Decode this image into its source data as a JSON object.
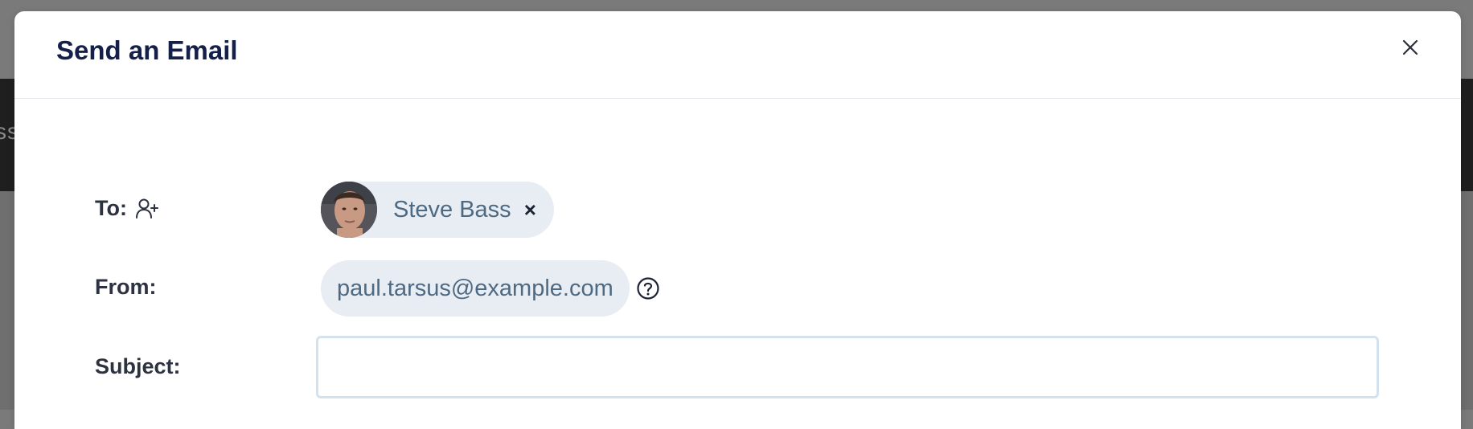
{
  "background": {
    "fragment_text": "ss"
  },
  "modal": {
    "title": "Send an Email",
    "close_icon": "close-icon"
  },
  "form": {
    "to": {
      "label": "To:",
      "icon": "add-user-icon",
      "recipients": [
        {
          "name": "Steve Bass",
          "remove_label": "×"
        }
      ]
    },
    "from": {
      "label": "From:",
      "value": "paul.tarsus@example.com",
      "help_icon": "help-circle-icon"
    },
    "subject": {
      "label": "Subject:",
      "value": "",
      "placeholder": ""
    }
  },
  "colors": {
    "title": "#14204a",
    "label": "#2d3240",
    "chip_bg": "#e8edf4",
    "chip_text": "#4e6a82",
    "input_border": "#d3e2ec",
    "overlay": "#7a7a7a"
  }
}
